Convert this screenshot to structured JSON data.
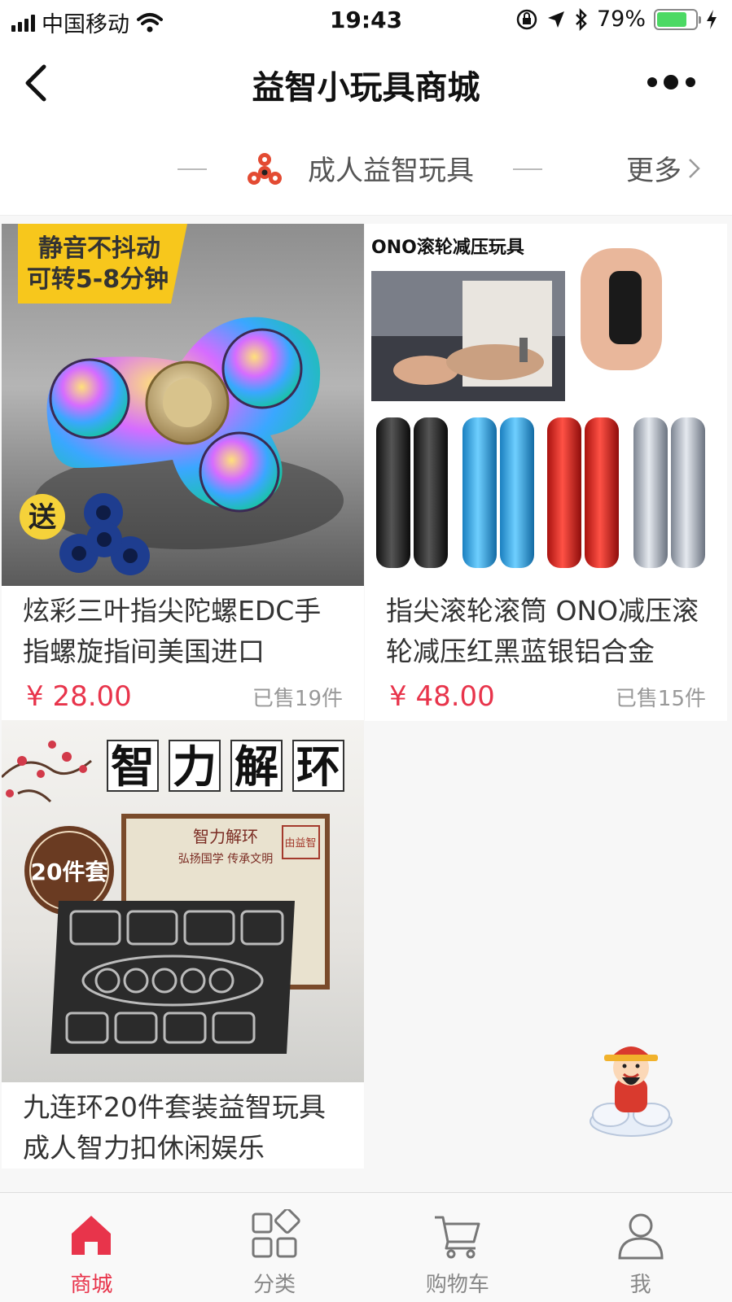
{
  "status_bar": {
    "carrier": "中国移动",
    "time": "19:43",
    "battery": "79%",
    "battery_level": 0.79
  },
  "nav": {
    "title": "益智小玩具商城"
  },
  "section": {
    "title": "成人益智玩具",
    "more_label": "更多"
  },
  "products": [
    {
      "name": "炫彩三叶指尖陀螺EDC手指螺旋指间美国进口",
      "price": "¥ 28.00",
      "sold": "已售19件",
      "banner_lines": [
        "静音不抖动",
        "可转5-8分钟"
      ],
      "gift_label": "送"
    },
    {
      "name": "指尖滚轮滚筒 ONO减压滚轮减压红黑蓝银铝合金",
      "price": "¥ 48.00",
      "sold": "已售15件",
      "banner_title": "ONO滚轮减压玩具"
    },
    {
      "name": "九连环20件套装益智玩具 成人智力扣休闲娱乐",
      "price": "",
      "sold": "",
      "headline_chars": [
        "智",
        "力",
        "解",
        "环"
      ],
      "badge": "20件套",
      "box_title": "智力解环",
      "box_subtitle": "弘扬国学 传承文明",
      "box_seal": "由益智"
    }
  ],
  "tabs": [
    {
      "label": "商城",
      "icon": "home-icon",
      "active": true
    },
    {
      "label": "分类",
      "icon": "category-icon",
      "active": false
    },
    {
      "label": "购物车",
      "icon": "cart-icon",
      "active": false
    },
    {
      "label": "我",
      "icon": "user-icon",
      "active": false
    }
  ],
  "colors": {
    "accent": "#e8344b",
    "battery_green": "#4cd964"
  }
}
